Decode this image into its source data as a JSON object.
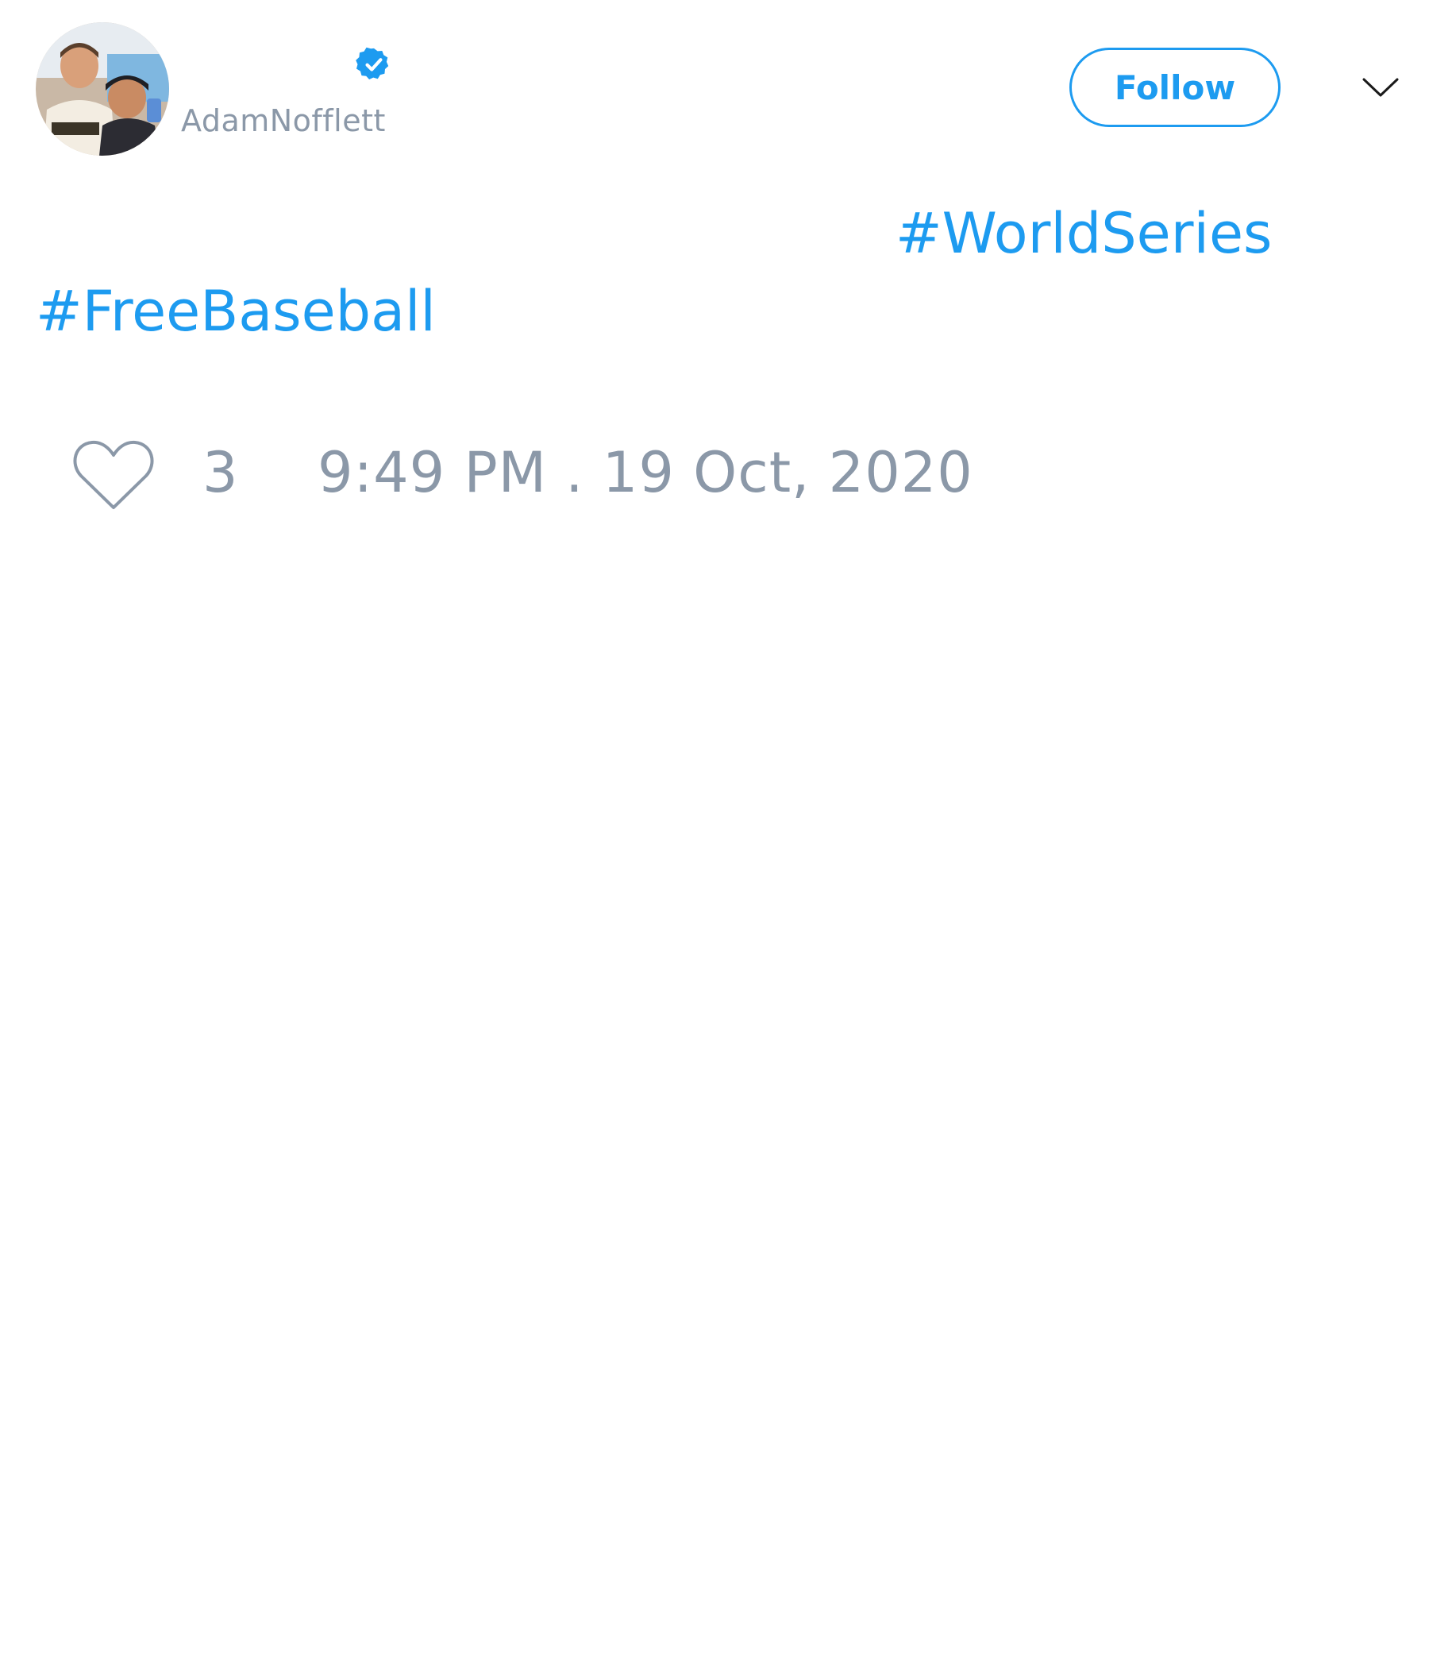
{
  "author": {
    "handle": "AdamNofflett",
    "verified": true,
    "avatar_description": "photo-avatar"
  },
  "header": {
    "follow_label": "Follow",
    "menu_icon": "chevron-down-icon"
  },
  "tweet": {
    "hashtags": [
      "#WorldSeries",
      "#FreeBaseball"
    ]
  },
  "footer": {
    "like_icon": "heart-outline-icon",
    "like_count": "3",
    "timestamp": "9:49 PM . 19 Oct, 2020"
  },
  "colors": {
    "accent": "#1d9bf0",
    "muted_text": "#8b98a8",
    "background": "#ffffff"
  }
}
